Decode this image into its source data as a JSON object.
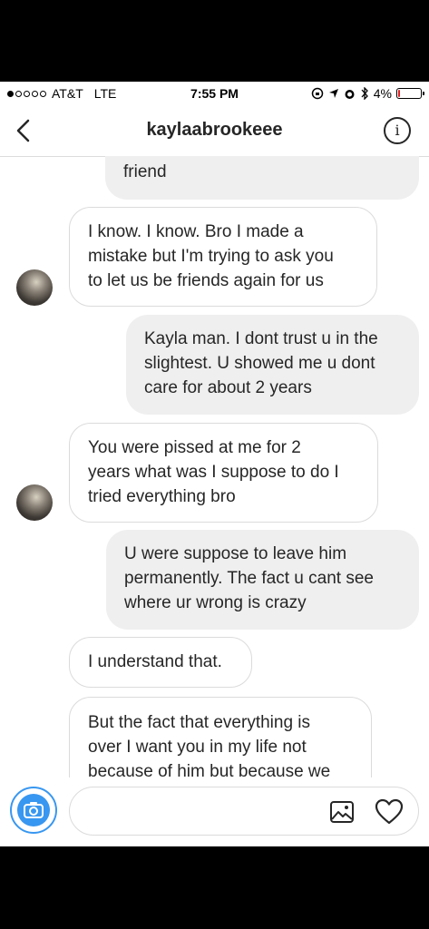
{
  "status_bar": {
    "carrier": "AT&T",
    "network": "LTE",
    "time": "7:55 PM",
    "battery": "4%",
    "signal_bars": 1,
    "battery_level": 0.04,
    "battery_color": "#e02020"
  },
  "header": {
    "title": "kaylaabrookeee",
    "info_glyph": "i"
  },
  "messages": [
    {
      "direction": "out",
      "text": "friend"
    },
    {
      "direction": "in",
      "text": "I know. I know. Bro I made a\nmistake but I'm trying to ask you\nto let us be friends again for us"
    },
    {
      "direction": "out",
      "text": "Kayla man. I dont trust u in the\nslightest. U showed me u dont\ncare for about 2 years"
    },
    {
      "direction": "in",
      "text": "You were pissed at me for 2\nyears what was I suppose to do I\ntried everything bro"
    },
    {
      "direction": "out",
      "text": "U were suppose to leave him\npermanently. The fact u cant see\nwhere ur wrong is crazy"
    },
    {
      "direction": "in",
      "text": "I understand that."
    },
    {
      "direction": "in",
      "text": "But the fact that everything is\nover I want you in my life not\nbecause of him but because we"
    }
  ],
  "composer": {
    "placeholder": "",
    "accent": "#3897f0"
  },
  "icons": [
    "back-chevron-icon",
    "info-icon",
    "camera-icon",
    "gallery-icon",
    "heart-icon"
  ]
}
